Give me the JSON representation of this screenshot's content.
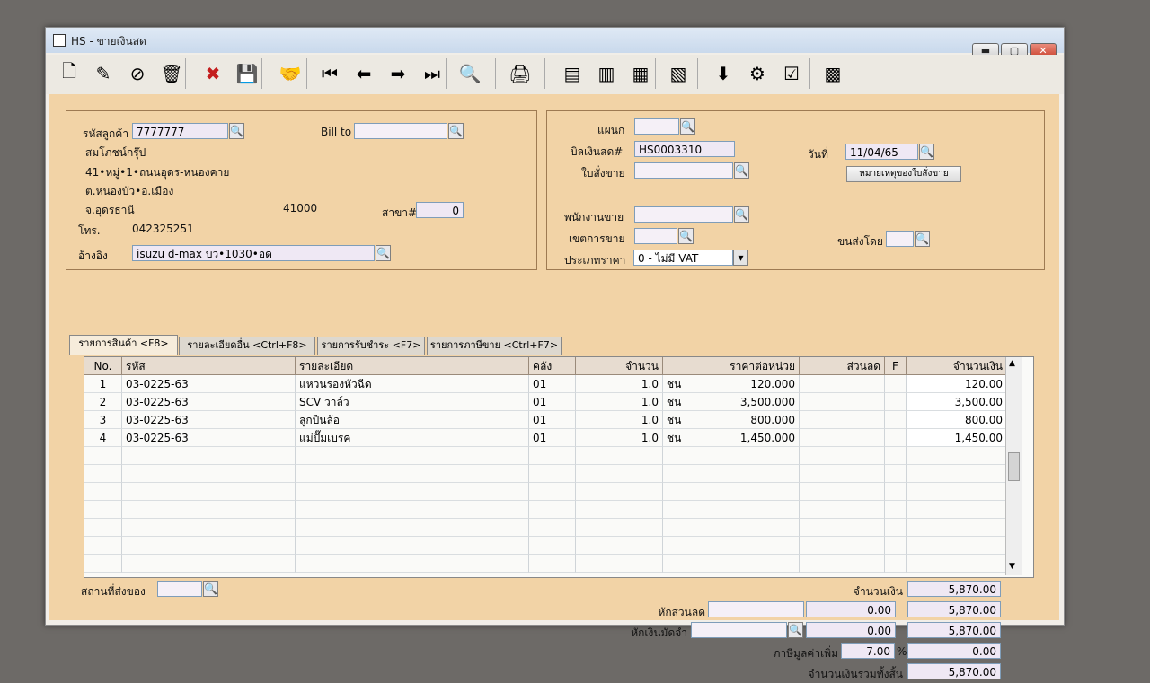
{
  "window": {
    "title": "HS - ขายเงินสด",
    "min_icon": "minimize-icon",
    "max_icon": "maximize-icon",
    "close_icon": "close-icon"
  },
  "toolbar": [
    {
      "name": "new-doc-icon",
      "glyph": "🗋"
    },
    {
      "name": "edit-icon",
      "glyph": "✎"
    },
    {
      "name": "cancel-doc-icon",
      "glyph": "⊘"
    },
    {
      "name": "delete-icon",
      "glyph": "🗑"
    },
    {
      "name": "close-circle-icon",
      "glyph": "✖"
    },
    {
      "name": "save-icon",
      "glyph": "💾"
    },
    {
      "name": "handshake-icon",
      "glyph": "🤝"
    },
    {
      "name": "first-record-icon",
      "glyph": "⏮"
    },
    {
      "name": "prev-record-icon",
      "glyph": "⬅"
    },
    {
      "name": "next-record-icon",
      "glyph": "➡"
    },
    {
      "name": "last-record-icon",
      "glyph": "⏭"
    },
    {
      "name": "find-icon",
      "glyph": "🔍"
    },
    {
      "name": "print-icon",
      "glyph": "🖨"
    },
    {
      "name": "screen-icon-1",
      "glyph": "▤"
    },
    {
      "name": "screen-icon-2",
      "glyph": "▥"
    },
    {
      "name": "screen-icon-3",
      "glyph": "▦"
    },
    {
      "name": "report-icon",
      "glyph": "▧"
    },
    {
      "name": "ok-down-icon",
      "glyph": "⬇"
    },
    {
      "name": "ok-tool-icon",
      "glyph": "⚙"
    },
    {
      "name": "ok-box-icon",
      "glyph": "☑"
    },
    {
      "name": "calc-icon",
      "glyph": "▩"
    }
  ],
  "customer": {
    "code_label": "รหัสลูกค้า",
    "code": "7777777",
    "name": "สมโภชน์กรุ๊ป",
    "addr1": "41•หมู่•1•ถนนอุดร-หนองคาย",
    "addr2": "ต.หนองบัว•อ.เมือง",
    "addr3": "จ.อุดรธานี",
    "zip": "41000",
    "branch_label": "สาขา#",
    "branch": "0",
    "phone_label": "โทร.",
    "phone": "042325251",
    "ref_label": "อ้างอิง",
    "ref": "isuzu d-max บว•1030•อด",
    "billto_label": "Bill to"
  },
  "doc": {
    "dept_label": "แผนก",
    "bill_label": "บิลเงินสด#",
    "bill_no": "HS0003310",
    "date_label": "วันที่",
    "date": "11/04/65",
    "so_label": "ใบสั่งขาย",
    "note_button": "หมายเหตุของใบสั่งขาย",
    "salesman_label": "พนักงานขาย",
    "area_label": "เขตการขาย",
    "ship_label": "ขนส่งโดย",
    "pricetype_label": "ประเภทราคา",
    "pricetype": "0 - ไม่มี VAT"
  },
  "tabs": [
    "รายการสินค้า <F8>",
    "รายละเอียดอื่น <Ctrl+F8>",
    "รายการรับชำระ <F7>",
    "รายการภาษีขาย <Ctrl+F7>"
  ],
  "grid": {
    "headers": [
      "No.",
      "รหัส",
      "รายละเอียด",
      "คลัง",
      "จำนวน",
      "",
      "ราคาต่อหน่วย",
      "ส่วนลด",
      "F",
      "จำนวนเงิน"
    ],
    "rows": [
      [
        "1",
        "03-0225-63",
        "แหวนรองหัวฉีด",
        "01",
        "1.0",
        "ชน",
        "120.000",
        "",
        "",
        "120.00"
      ],
      [
        "2",
        "03-0225-63",
        "SCV วาล์ว",
        "01",
        "1.0",
        "ชน",
        "3,500.000",
        "",
        "",
        "3,500.00"
      ],
      [
        "3",
        "03-0225-63",
        "ลูกปืนล้อ",
        "01",
        "1.0",
        "ชน",
        "800.000",
        "",
        "",
        "800.00"
      ],
      [
        "4",
        "03-0225-63",
        "แม่ปั๊มเบรค",
        "01",
        "1.0",
        "ชน",
        "1,450.000",
        "",
        "",
        "1,450.00"
      ]
    ]
  },
  "footer": {
    "ship_place_label": "สถานที่ส่งของ",
    "amount_label": "จำนวนเงิน",
    "amount": "5,870.00",
    "discount_label": "หักส่วนลด",
    "discount": "0.00",
    "after_discount": "5,870.00",
    "deposit_label": "หักเงินมัดจำ",
    "deposit": "0.00",
    "after_deposit": "5,870.00",
    "vat_label": "ภาษีมูลค่าเพิ่ม",
    "vat_rate": "7.00",
    "vat_pct": "%",
    "vat_amount": "0.00",
    "total_label": "จำนวนเงินรวมทั้งสิ้น",
    "total": "5,870.00"
  }
}
